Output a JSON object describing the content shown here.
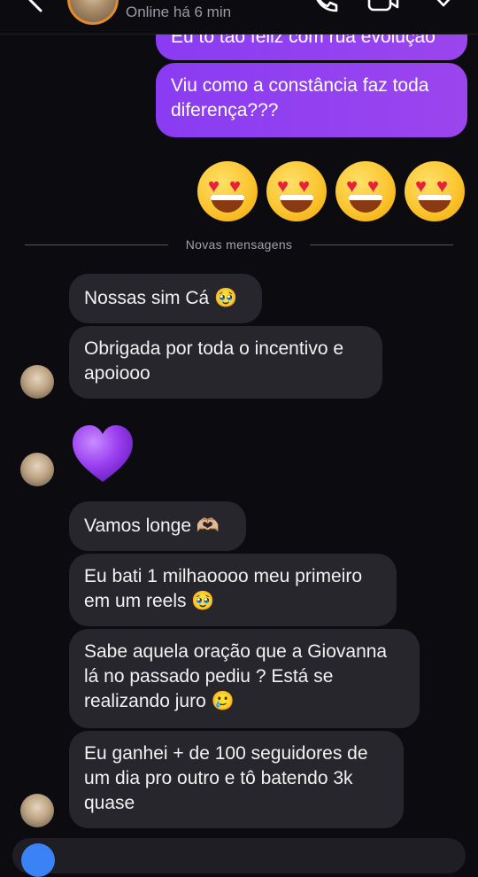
{
  "header": {
    "status": "Online há 6 min"
  },
  "divider": {
    "label": "Novas mensagens"
  },
  "messages": {
    "out_1": "Eu tô tão feliz com rua evolução",
    "out_2": "Viu como a constância faz toda diferença???",
    "in_1": "Nossas sim Cá 🥹",
    "in_2": "Obrigada por toda o incentivo e apoiooo",
    "in_3": "Vamos longe 🫶🏼",
    "in_4": "Eu bati 1 milhaoooo meu primeiro em um reels 🥹",
    "in_5": "Sabe aquela oração que a Giovanna lá no passado pediu ? Está se realizando juro 🥲",
    "in_6": "Eu ganhei + de 100 seguidores de um dia pro outro e tô batendo 3k quase"
  },
  "reactions": {
    "outgoing_emoji": [
      "heart-eyes",
      "heart-eyes",
      "heart-eyes",
      "heart-eyes"
    ],
    "incoming_emoji": "purple-heart"
  },
  "colors": {
    "outgoing_bubble": "#9b45ee",
    "incoming_bubble": "#26262c",
    "background": "#0c0c10"
  }
}
